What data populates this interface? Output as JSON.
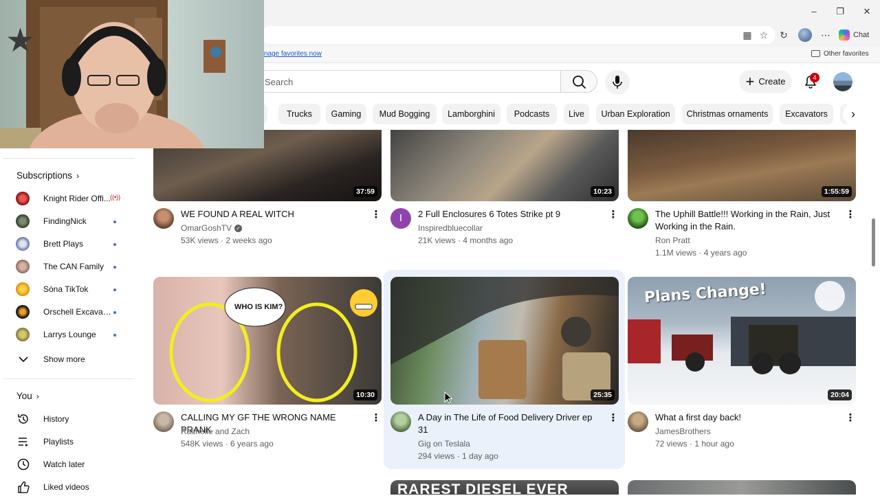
{
  "browser": {
    "favorites_link": "nage favorites now",
    "other_favorites": "Other favorites",
    "chat_label": "Chat",
    "window_controls": [
      "minimize-icon",
      "restore-icon",
      "close-icon"
    ]
  },
  "header": {
    "search_placeholder": "Search",
    "create_label": "Create",
    "notification_count": "4"
  },
  "chips": [
    "s",
    "Trucks",
    "Gaming",
    "Mud Bogging",
    "Lamborghini",
    "Podcasts",
    "Live",
    "Urban Exploration",
    "Christmas ornaments",
    "Excavators"
  ],
  "sidebar": {
    "subscriptions_title": "Subscriptions",
    "subscriptions": [
      {
        "name": "Knight Rider Offi...",
        "status": "live"
      },
      {
        "name": "FindingNick",
        "status": "new"
      },
      {
        "name": "Brett Plays",
        "status": "new"
      },
      {
        "name": "The CAN Family",
        "status": "new"
      },
      {
        "name": "Sóna TikTok",
        "status": "new"
      },
      {
        "name": "Orschell Excavati...",
        "status": "new"
      },
      {
        "name": "Larrys Lounge",
        "status": "new"
      }
    ],
    "show_more": "Show more",
    "you_title": "You",
    "you_items": [
      {
        "label": "History",
        "icon": "history-icon"
      },
      {
        "label": "Playlists",
        "icon": "playlists-icon"
      },
      {
        "label": "Watch later",
        "icon": "watch-later-icon"
      },
      {
        "label": "Liked videos",
        "icon": "thumbs-up-icon"
      }
    ]
  },
  "videos": [
    {
      "title": "WE FOUND A REAL WITCH",
      "channel": "OmarGoshTV",
      "verified": true,
      "views": "53K views",
      "age": "2 weeks ago",
      "duration": "37:59"
    },
    {
      "title": "2 Full Enclosures 6 Totes Strike pt 9",
      "channel": "Inspiredbluecollar",
      "verified": false,
      "views": "21K views",
      "age": "4 months ago",
      "duration": "10:23",
      "avatar_letter": "I"
    },
    {
      "title": "The Uphill Battle!!!  Working in the Rain, Just Working in the Rain.",
      "channel": "Ron Pratt",
      "verified": false,
      "views": "1.1M views",
      "age": "4 years ago",
      "duration": "1:55:59"
    },
    {
      "title": "CALLING MY GF THE WRONG NAME PRANK",
      "channel": "Rachelle and Zach",
      "verified": false,
      "views": "548K views",
      "age": "6 years ago",
      "duration": "10:30",
      "thumb_text": "WHO IS KIM?"
    },
    {
      "title": "A Day in The Life of Food Delivery Driver ep 31",
      "channel": "Gig on Teslala",
      "verified": false,
      "views": "294 views",
      "age": "1 day ago",
      "duration": "25:35"
    },
    {
      "title": "What a first day back!",
      "channel": "JamesBrothers",
      "verified": false,
      "views": "72 views",
      "age": "1 hour ago",
      "duration": "20:04",
      "thumb_text": "Plans Change!"
    },
    {
      "thumb_text": "RAREST DIESEL EVER"
    }
  ],
  "colors": {
    "accent_red": "#cc0000",
    "text_primary": "#0f0f0f",
    "text_secondary": "#606060",
    "chip_bg": "#f2f2f2",
    "hover_bg": "#eaf1fb",
    "link_blue": "#1a56c8"
  }
}
